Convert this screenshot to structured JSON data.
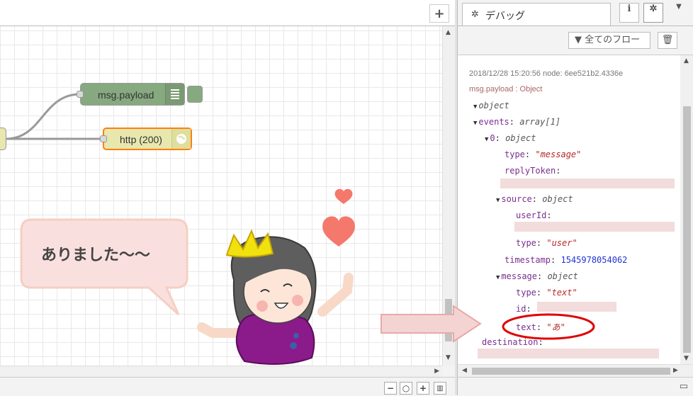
{
  "workspace": {
    "add_tab_label": "+",
    "nodes": {
      "debug_label": "msg.payload",
      "http_label": "http (200)"
    },
    "bubble_text": "ありました〜〜",
    "zoom_buttons": [
      "−",
      "○",
      "+"
    ]
  },
  "sidebar": {
    "tab_label": "デバッグ",
    "info_button": "i",
    "filter_label": "全てのフロー",
    "message": {
      "meta": "2018/12/28 15:20:56   node: 6ee521b2.4336e",
      "topic": "msg.payload : Object",
      "tree": {
        "root": "object",
        "events_key": "events",
        "events_type": "array[1]",
        "item0_key": "0",
        "item0_type": "object",
        "type_key": "type",
        "type_val": "\"message\"",
        "replyToken_key": "replyToken",
        "source_key": "source",
        "source_type": "object",
        "userId_key": "userId",
        "source_type_key": "type",
        "source_type_val": "\"user\"",
        "timestamp_key": "timestamp",
        "timestamp_val": "1545978054062",
        "message_key": "message",
        "message_type": "object",
        "msg_type_key": "type",
        "msg_type_val": "\"text\"",
        "id_key": "id",
        "text_key": "text",
        "text_val": "\"あ\"",
        "destination_key": "destination"
      }
    }
  },
  "colors": {
    "debug_node": "#87a980",
    "http_node": "#e7e7ae",
    "selected_border": "#ff7f0e",
    "highlight_circle": "#e00000",
    "arrow_fill": "#f4d3d3",
    "bubble_fill": "#f9e0de",
    "heart": "#f4786b",
    "crown": "#f1e10e",
    "dress": "#8b1a8a"
  }
}
